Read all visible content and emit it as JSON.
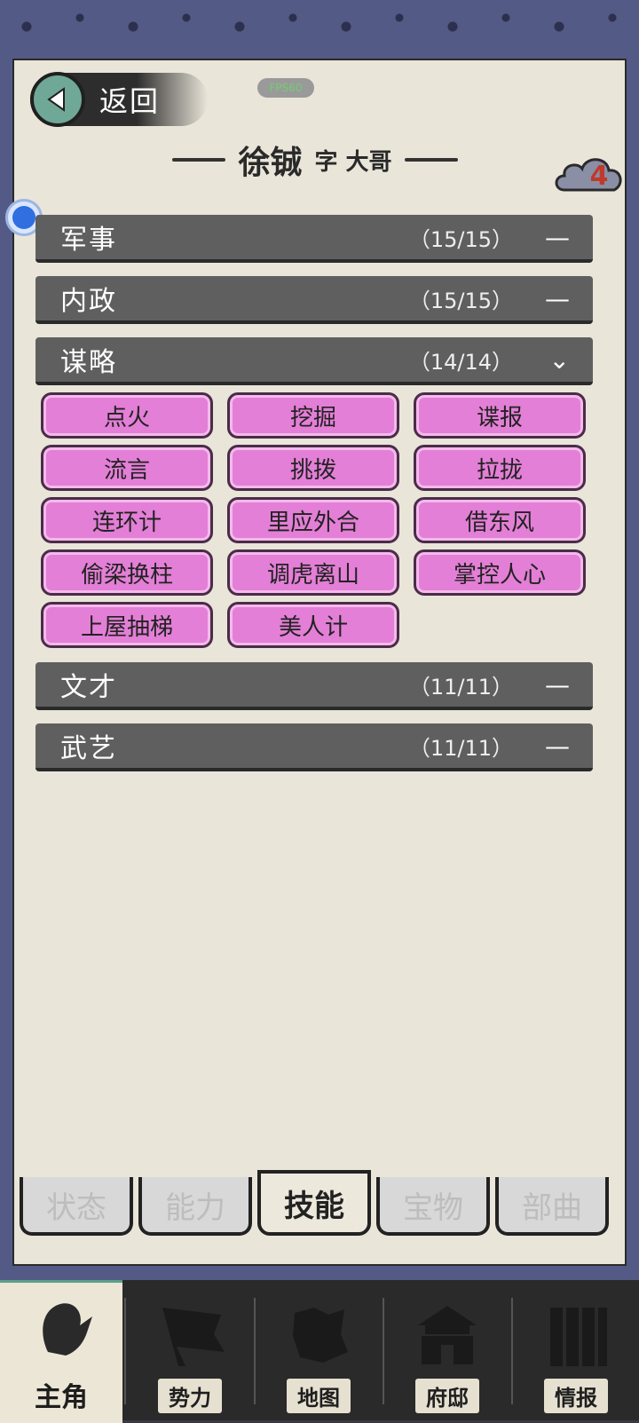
{
  "header": {
    "back_label": "返回",
    "fps_label": "FPS60",
    "name": "徐铖",
    "style_name": "字 大哥",
    "badge_count": "4"
  },
  "categories": [
    {
      "name": "军事",
      "count": "（15/15）",
      "toggle": "—"
    },
    {
      "name": "内政",
      "count": "（15/15）",
      "toggle": "—"
    },
    {
      "name": "谋略",
      "count": "（14/14）",
      "toggle": "⌄"
    },
    {
      "name": "文才",
      "count": "（11/11）",
      "toggle": "—"
    },
    {
      "name": "武艺",
      "count": "（11/11）",
      "toggle": "—"
    }
  ],
  "skills": [
    "点火",
    "挖掘",
    "谍报",
    "流言",
    "挑拨",
    "拉拢",
    "连环计",
    "里应外合",
    "借东风",
    "偷梁换柱",
    "调虎离山",
    "掌控人心",
    "上屋抽梯",
    "美人计"
  ],
  "tabs": [
    {
      "label": "状态"
    },
    {
      "label": "能力"
    },
    {
      "label": "技能"
    },
    {
      "label": "宝物"
    },
    {
      "label": "部曲"
    }
  ],
  "nav": [
    {
      "label": "主角"
    },
    {
      "label": "势力"
    },
    {
      "label": "地图"
    },
    {
      "label": "府邸"
    },
    {
      "label": "情报"
    }
  ],
  "colors": {
    "skill_button": "#e37fd6",
    "category_bar": "#5f5f5f",
    "paper": "#e9e5d9",
    "accent": "#6fa896"
  }
}
